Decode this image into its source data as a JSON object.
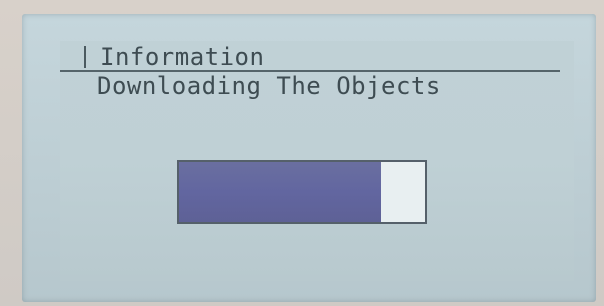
{
  "dialog": {
    "title": "Information",
    "message": "Downloading The Objects"
  },
  "progress": {
    "fraction": 0.82
  },
  "colors": {
    "lcd_background": "#bfd0d5",
    "text": "#3e4c52",
    "progress_fill": "#6266a0",
    "progress_empty": "#e8eff1"
  }
}
